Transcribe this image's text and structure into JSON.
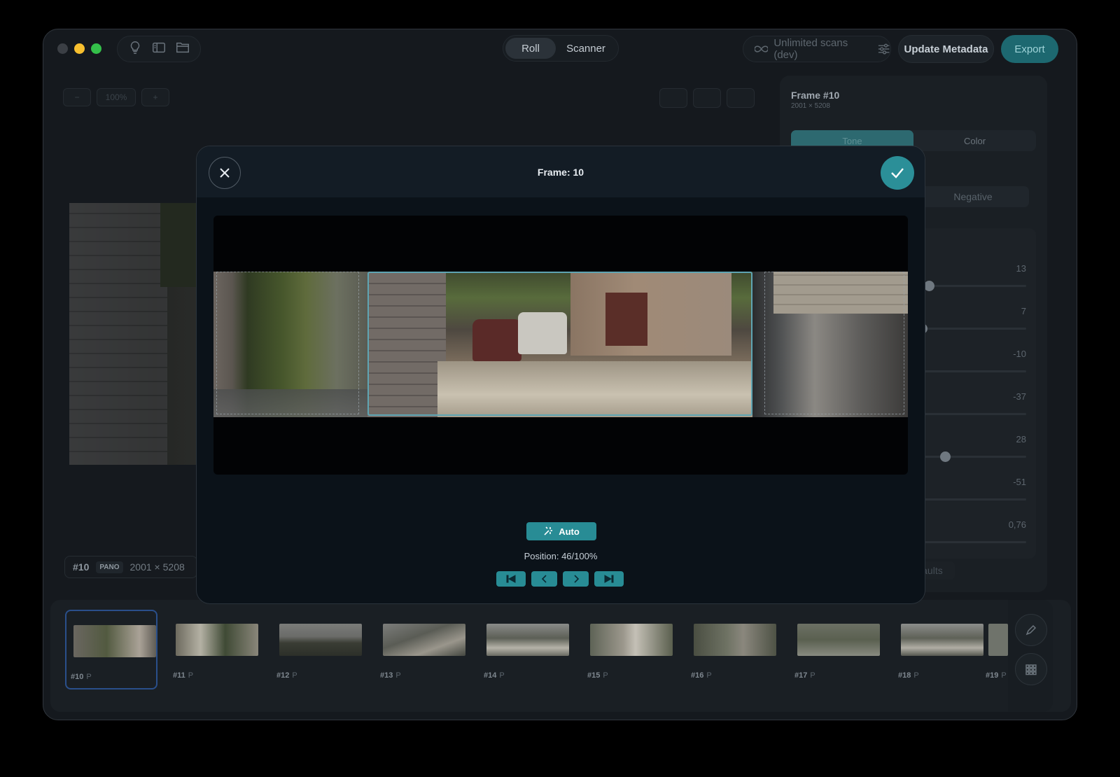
{
  "toolbar": {
    "tabs": [
      {
        "label": "Roll",
        "active": true
      },
      {
        "label": "Scanner",
        "active": false
      }
    ],
    "scans_label": "Unlimited scans (dev)",
    "update_metadata_label": "Update Metadata",
    "export_label": "Export",
    "accent_color": "#288c95"
  },
  "background": {
    "zoom_level": "100%",
    "info_chip": {
      "frame": "#10",
      "badge": "PANO",
      "size": "2001 × 5208"
    },
    "side_panel": {
      "title": "Frame #10",
      "subtitle": "2001 × 5208",
      "tabs": [
        "Tone",
        "Color"
      ],
      "mode_label": "Negative",
      "slider_values": [
        "13",
        "7",
        "-10",
        "-37",
        "28",
        "-51",
        "0,76"
      ],
      "reset_label": "o defaults"
    }
  },
  "modal": {
    "title": "Frame: 10",
    "auto_label": "Auto",
    "position_text": "Position: 46/100%",
    "position_fraction": 0.46
  },
  "filmstrip": {
    "frames": [
      {
        "label": "#10",
        "tag": "P",
        "selected": true
      },
      {
        "label": "#11",
        "tag": "P",
        "selected": false
      },
      {
        "label": "#12",
        "tag": "P",
        "selected": false
      },
      {
        "label": "#13",
        "tag": "P",
        "selected": false
      },
      {
        "label": "#14",
        "tag": "P",
        "selected": false
      },
      {
        "label": "#15",
        "tag": "P",
        "selected": false
      },
      {
        "label": "#16",
        "tag": "P",
        "selected": false
      },
      {
        "label": "#17",
        "tag": "P",
        "selected": false
      },
      {
        "label": "#18",
        "tag": "P",
        "selected": false
      },
      {
        "label": "#19",
        "tag": "P",
        "selected": false
      }
    ]
  }
}
